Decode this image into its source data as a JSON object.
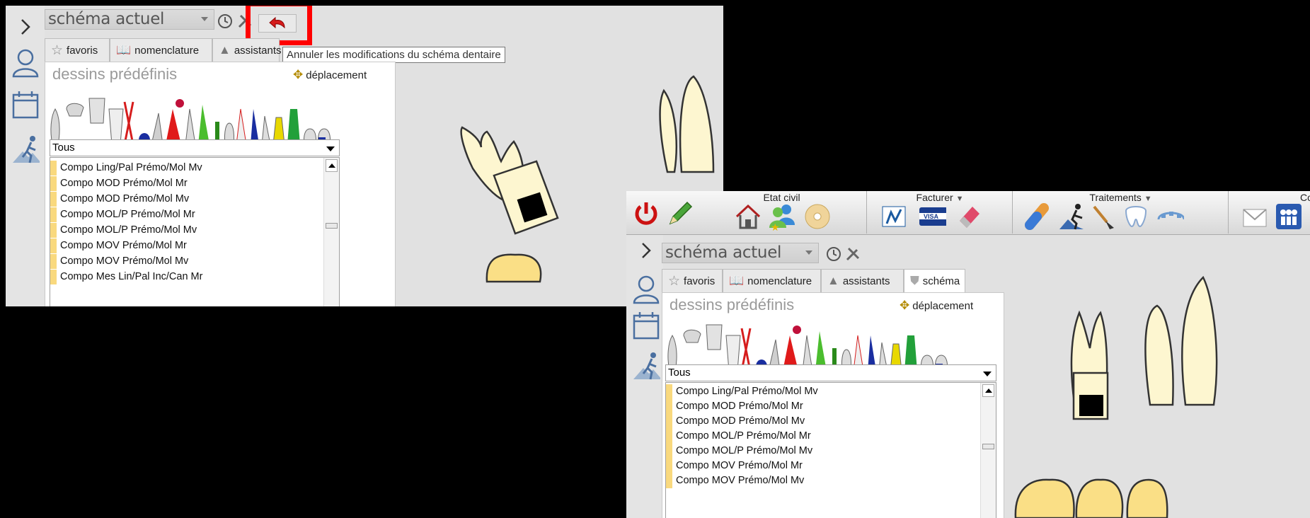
{
  "window1": {
    "schema_label": "schéma actuel",
    "tabs": [
      {
        "label": "favoris"
      },
      {
        "label": "nomenclature"
      },
      {
        "label": "assistants"
      }
    ],
    "tooltip": "Annuler les modifications du schéma dentaire",
    "section_title": "dessins prédéfinis",
    "move_label": "déplacement",
    "filter_value": "Tous",
    "list_items": [
      "Compo Ling/Pal Prémo/Mol Mv",
      "Compo MOD Prémo/Mol Mr",
      "Compo MOD Prémo/Mol Mv",
      "Compo MOL/P Prémo/Mol Mr",
      "Compo MOL/P Prémo/Mol Mv",
      "Compo MOV Prémo/Mol Mr",
      "Compo MOV Prémo/Mol Mv",
      "Compo Mes Lin/Pal Inc/Can Mr"
    ]
  },
  "window2": {
    "toolbar_groups": [
      {
        "label": "Etat civil"
      },
      {
        "label": "Facturer"
      },
      {
        "label": "Traitements"
      },
      {
        "label": "Commun"
      }
    ],
    "schema_label": "schéma actuel",
    "tabs": [
      {
        "label": "favoris"
      },
      {
        "label": "nomenclature"
      },
      {
        "label": "assistants"
      },
      {
        "label": "schéma"
      }
    ],
    "section_title": "dessins prédéfinis",
    "move_label": "déplacement",
    "filter_value": "Tous",
    "list_items": [
      "Compo Ling/Pal Prémo/Mol Mv",
      "Compo MOD Prémo/Mol Mr",
      "Compo MOD Prémo/Mol Mv",
      "Compo MOL/P Prémo/Mol Mr",
      "Compo MOL/P Prémo/Mol Mv",
      "Compo MOV Prémo/Mol Mr",
      "Compo MOV Prémo/Mol Mv"
    ]
  },
  "colors": {
    "highlight": "#ff0000",
    "list_swatch": "#f9d97e",
    "tooth": "#fdf6d0",
    "tooth_yellow": "#fadf86"
  }
}
